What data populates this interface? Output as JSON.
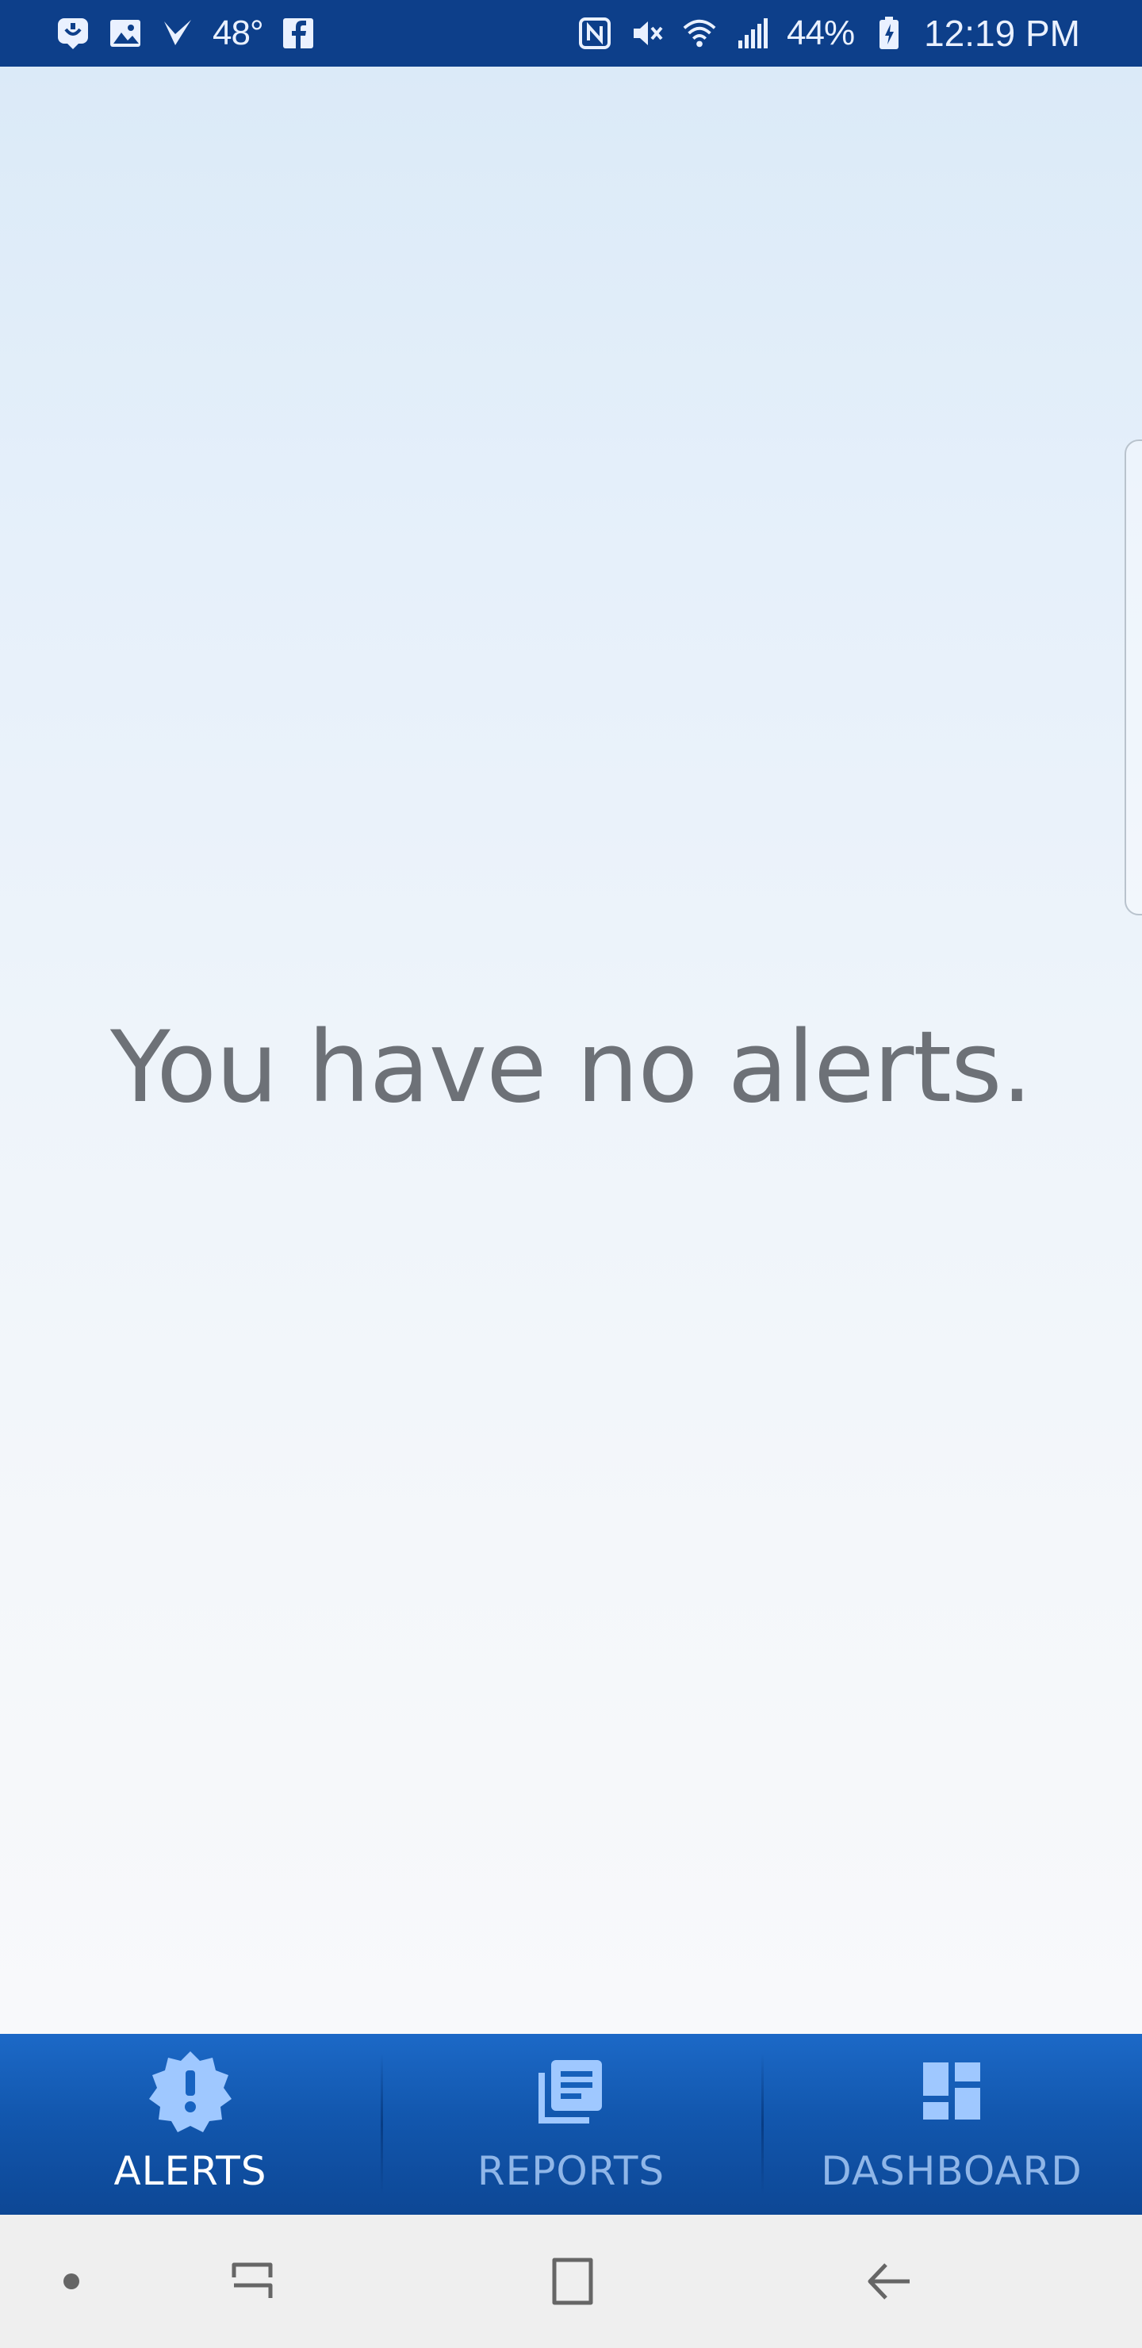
{
  "status_bar": {
    "temperature": "48°",
    "battery": "44%",
    "time": "12:19 PM",
    "left_icons": [
      "messenger-icon",
      "image-icon",
      "check-icon",
      "facebook-icon"
    ],
    "right_icons": [
      "nfc-icon",
      "mute-icon",
      "wifi-icon",
      "signal-icon",
      "battery-icon"
    ]
  },
  "main": {
    "empty_message": "You have no alerts."
  },
  "bottom_nav": {
    "items": [
      {
        "label": "ALERTS",
        "icon": "alert-badge-icon",
        "active": true
      },
      {
        "label": "REPORTS",
        "icon": "reports-icon",
        "active": false
      },
      {
        "label": "DASHBOARD",
        "icon": "dashboard-icon",
        "active": false
      }
    ]
  },
  "system_nav": {
    "buttons": [
      "dot-button",
      "recents-button",
      "home-button",
      "back-button"
    ]
  },
  "colors": {
    "status_bar": "#0d3f8a",
    "nav_active": "#ffffff",
    "nav_inactive": "#8fb6e8",
    "icon_fill": "#9fc8ff",
    "message_text": "#6d7177"
  }
}
